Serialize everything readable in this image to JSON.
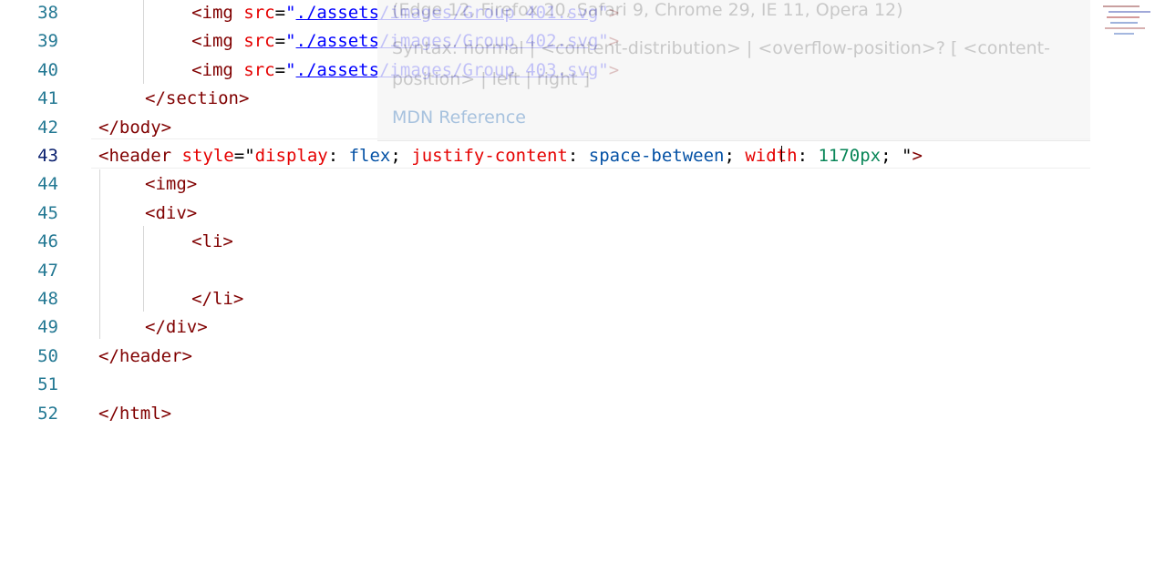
{
  "editor": {
    "lines": [
      {
        "number": "38",
        "indent": "        ",
        "tokens": [
          [
            "tag",
            "<img"
          ],
          [
            "plain",
            " "
          ],
          [
            "attr",
            "src"
          ],
          [
            "plain",
            "="
          ],
          [
            "str",
            "\""
          ],
          [
            "link",
            "./assets/images/Group 401.svg"
          ],
          [
            "str",
            "\""
          ],
          [
            "tag",
            ">"
          ]
        ]
      },
      {
        "number": "39",
        "indent": "        ",
        "tokens": [
          [
            "tag",
            "<img"
          ],
          [
            "plain",
            " "
          ],
          [
            "attr",
            "src"
          ],
          [
            "plain",
            "="
          ],
          [
            "str",
            "\""
          ],
          [
            "link",
            "./assets/images/Group 402.svg"
          ],
          [
            "str",
            "\""
          ],
          [
            "tag",
            ">"
          ]
        ]
      },
      {
        "number": "40",
        "indent": "        ",
        "tokens": [
          [
            "tag",
            "<img"
          ],
          [
            "plain",
            " "
          ],
          [
            "attr",
            "src"
          ],
          [
            "plain",
            "="
          ],
          [
            "str",
            "\""
          ],
          [
            "link",
            "./assets/images/Group 403.svg"
          ],
          [
            "str",
            "\""
          ],
          [
            "tag",
            ">"
          ]
        ]
      },
      {
        "number": "41",
        "indent": "    ",
        "tokens": [
          [
            "tag",
            "</section>"
          ]
        ]
      },
      {
        "number": "42",
        "indent": "",
        "tokens": [
          [
            "tag",
            "</body>"
          ]
        ]
      },
      {
        "number": "43",
        "indent": "",
        "active": true,
        "tokens": [
          [
            "tag",
            "<header"
          ],
          [
            "plain",
            " "
          ],
          [
            "attr",
            "style"
          ],
          [
            "plain",
            "="
          ],
          [
            "plain",
            "\""
          ],
          [
            "prop",
            "display"
          ],
          [
            "plain",
            ": "
          ],
          [
            "val",
            "flex"
          ],
          [
            "plain",
            "; "
          ],
          [
            "prop",
            "justify-content"
          ],
          [
            "plain",
            ": "
          ],
          [
            "val",
            "space-between"
          ],
          [
            "plain",
            "; "
          ],
          [
            "prop",
            "width"
          ],
          [
            "plain",
            ": "
          ],
          [
            "num",
            "1170px"
          ],
          [
            "plain",
            "; "
          ],
          [
            "plain",
            "\""
          ],
          [
            "tag",
            ">"
          ]
        ]
      },
      {
        "number": "44",
        "indent": "    ",
        "tokens": [
          [
            "tag",
            "<img>"
          ]
        ]
      },
      {
        "number": "45",
        "indent": "    ",
        "tokens": [
          [
            "tag",
            "<div>"
          ]
        ]
      },
      {
        "number": "46",
        "indent": "        ",
        "tokens": [
          [
            "tag",
            "<li>"
          ]
        ]
      },
      {
        "number": "47",
        "indent": "",
        "tokens": []
      },
      {
        "number": "48",
        "indent": "        ",
        "tokens": [
          [
            "tag",
            "</li>"
          ]
        ]
      },
      {
        "number": "49",
        "indent": "    ",
        "tokens": [
          [
            "tag",
            "</div>"
          ]
        ]
      },
      {
        "number": "50",
        "indent": "",
        "tokens": [
          [
            "tag",
            "</header>"
          ]
        ]
      },
      {
        "number": "51",
        "indent": "",
        "tokens": []
      },
      {
        "number": "52",
        "indent": "",
        "tokens": [
          [
            "tag",
            "</html>"
          ]
        ]
      }
    ]
  },
  "hover": {
    "browsers": "(Edge 12, Firefox 20, Safari 9, Chrome 29, IE 11, Opera 12)",
    "syntax_line1": "Syntax: normal | <content-distribution> | <overflow-position>? [ <content-",
    "syntax_line2": "position> | left | right ]",
    "reference": "MDN Reference"
  },
  "colors": {
    "tag": "#800000",
    "attribute": "#e50000",
    "string": "#0000ff",
    "value": "#0451a5",
    "number": "#098658",
    "line_number": "#237893"
  }
}
